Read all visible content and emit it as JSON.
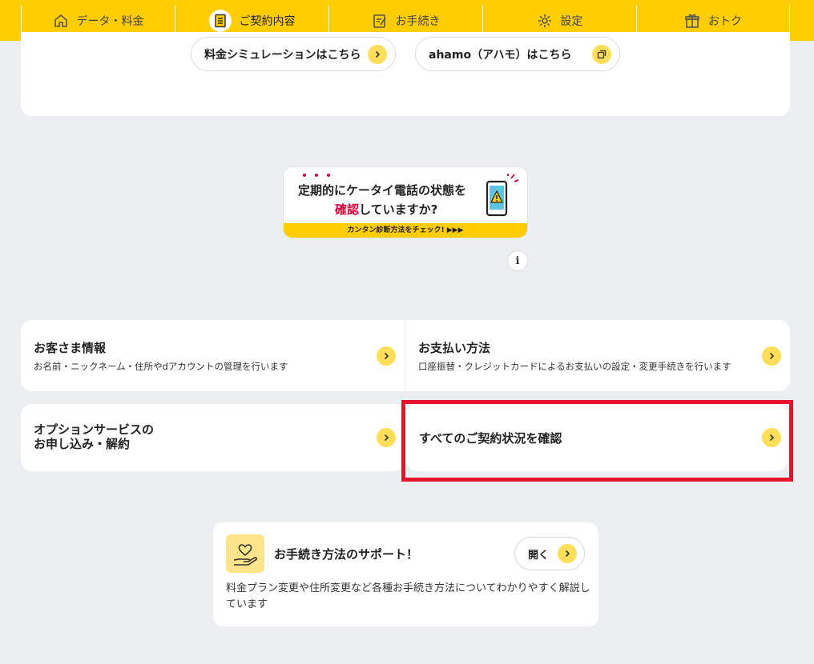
{
  "nav": {
    "items": [
      {
        "label": "データ・料金",
        "icon": "home-icon"
      },
      {
        "label": "ご契約内容",
        "icon": "document-icon",
        "active": true
      },
      {
        "label": "お手続き",
        "icon": "edit-icon"
      },
      {
        "label": "設定",
        "icon": "settings-icon"
      },
      {
        "label": "おトク",
        "icon": "gift-icon"
      }
    ]
  },
  "top_card": {
    "sim_label": "料金シミュレーションはこちら",
    "ahamo_label": "ahamo（アハモ）はこちら"
  },
  "banner": {
    "line1": "定期的にケータイ電話の状態を",
    "line2_em": "確認",
    "line2_rest": "していますか?",
    "strip": "カンタン診断方法をチェック! ▶▶▶"
  },
  "info_label": "i",
  "menu": {
    "customer_info": {
      "title": "お客さま情報",
      "desc": "お名前・ニックネーム・住所やdアカウントの管理を行います"
    },
    "payment": {
      "title": "お支払い方法",
      "desc": "口座振替・クレジットカードによるお支払いの設定・変更手続きを行います"
    },
    "options": {
      "title_line1": "オプションサービスの",
      "title_line2": "お申し込み・解約"
    },
    "all_contracts": {
      "title": "すべてのご契約状況を確認"
    }
  },
  "support": {
    "title": "お手続き方法のサポート！",
    "open_label": "開く",
    "desc": "料金プラン変更や住所変更など各種お手続き方法についてわかりやすく解説しています"
  },
  "colors": {
    "brand_yellow": "#ffcd00",
    "chevron_yellow": "#ffde5a",
    "highlight_red": "#e8112d",
    "accent_red": "#d6003a"
  }
}
